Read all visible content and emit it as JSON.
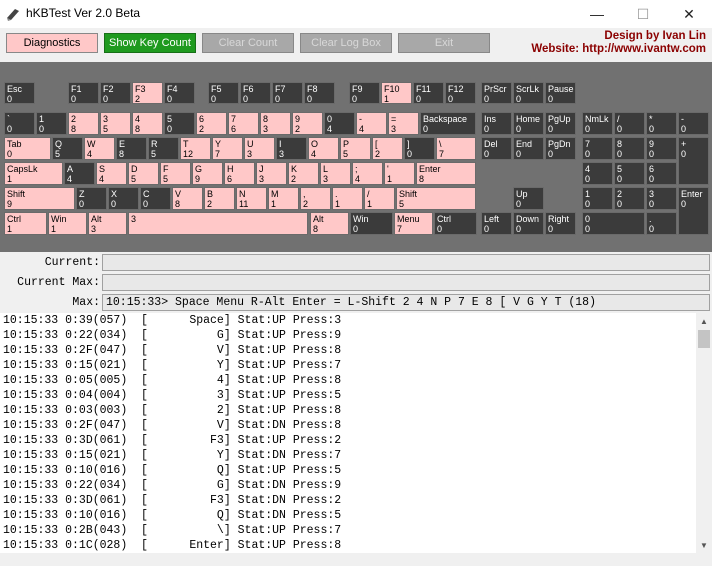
{
  "window": {
    "title": "hKBTest Ver 2.0 Beta",
    "minimize": "—",
    "maximize": "☐",
    "close": "✕"
  },
  "toolbar": {
    "diagnostics": "Diagnostics",
    "show_key_count": "Show Key Count",
    "clear_count": "Clear Count",
    "clear_log_box": "Clear Log Box",
    "exit": "Exit"
  },
  "credit": {
    "design": "Design by Ivan Lin",
    "website": "Website: http://www.ivantw.com"
  },
  "status": {
    "current_label": "Current:",
    "current_max_label": "Current Max:",
    "max_label": "Max:",
    "current_value": "",
    "current_max_value": "",
    "max_value": "10:15:33> Space Menu R-Alt Enter = L-Shift 2 4 N P 7 E 8 [ V G Y T (18)"
  },
  "keys": [
    [
      "Esc",
      "0",
      "up"
    ],
    [
      "F1",
      "0",
      "up"
    ],
    [
      "F2",
      "0",
      "up"
    ],
    [
      "F3",
      "2",
      "dn"
    ],
    [
      "F4",
      "0",
      "up"
    ],
    [
      "F5",
      "0",
      "up"
    ],
    [
      "F6",
      "0",
      "up"
    ],
    [
      "F7",
      "0",
      "up"
    ],
    [
      "F8",
      "0",
      "up"
    ],
    [
      "F9",
      "0",
      "up"
    ],
    [
      "F10",
      "1",
      "dn"
    ],
    [
      "F11",
      "0",
      "up"
    ],
    [
      "F12",
      "0",
      "up"
    ],
    [
      "PrScr",
      "0",
      "up"
    ],
    [
      "ScrLk",
      "0",
      "up"
    ],
    [
      "Pause",
      "0",
      "up"
    ],
    [
      "`",
      "0",
      "up"
    ],
    [
      "1",
      "0",
      "up"
    ],
    [
      "2",
      "8",
      "dn"
    ],
    [
      "3",
      "5",
      "dn"
    ],
    [
      "4",
      "8",
      "dn"
    ],
    [
      "5",
      "0",
      "up"
    ],
    [
      "6",
      "2",
      "dn"
    ],
    [
      "7",
      "6",
      "dn"
    ],
    [
      "8",
      "3",
      "dn"
    ],
    [
      "9",
      "2",
      "dn"
    ],
    [
      "0",
      "4",
      "up"
    ],
    [
      "-",
      "4",
      "dn"
    ],
    [
      "=",
      "3",
      "dn"
    ],
    [
      "Backspace",
      "0",
      "up"
    ],
    [
      "Ins",
      "0",
      "up"
    ],
    [
      "Home",
      "0",
      "up"
    ],
    [
      "PgUp",
      "0",
      "up"
    ],
    [
      "NmLk",
      "0",
      "up"
    ],
    [
      "/",
      "0",
      "up"
    ],
    [
      "*",
      "0",
      "up"
    ],
    [
      "-",
      "0",
      "up"
    ],
    [
      "Tab",
      "0",
      "dn"
    ],
    [
      "Q",
      "5",
      "up"
    ],
    [
      "W",
      "4",
      "dn"
    ],
    [
      "E",
      "8",
      "up"
    ],
    [
      "R",
      "5",
      "up"
    ],
    [
      "T",
      "12",
      "dn"
    ],
    [
      "Y",
      "7",
      "dn"
    ],
    [
      "U",
      "3",
      "dn"
    ],
    [
      "I",
      "3",
      "up"
    ],
    [
      "O",
      "4",
      "dn"
    ],
    [
      "P",
      "5",
      "dn"
    ],
    [
      "[",
      "2",
      "dn"
    ],
    [
      "]",
      "0",
      "up"
    ],
    [
      "\\",
      "7",
      "dn"
    ],
    [
      "Del",
      "0",
      "up"
    ],
    [
      "End",
      "0",
      "up"
    ],
    [
      "PgDn",
      "0",
      "up"
    ],
    [
      "7",
      "0",
      "up"
    ],
    [
      "8",
      "0",
      "up"
    ],
    [
      "9",
      "0",
      "up"
    ],
    [
      "+",
      "0",
      "up"
    ],
    [
      "CapsLk",
      "1",
      "dn"
    ],
    [
      "A",
      "4",
      "up"
    ],
    [
      "S",
      "4",
      "dn"
    ],
    [
      "D",
      "5",
      "dn"
    ],
    [
      "F",
      "5",
      "dn"
    ],
    [
      "G",
      "9",
      "dn"
    ],
    [
      "H",
      "6",
      "dn"
    ],
    [
      "J",
      "3",
      "dn"
    ],
    [
      "K",
      "2",
      "dn"
    ],
    [
      "L",
      "3",
      "dn"
    ],
    [
      ";",
      "4",
      "dn"
    ],
    [
      "'",
      "1",
      "dn"
    ],
    [
      "Enter",
      "8",
      "dn"
    ],
    [
      "4",
      "0",
      "up"
    ],
    [
      "5",
      "0",
      "up"
    ],
    [
      "6",
      "0",
      "up"
    ],
    [
      "Shift",
      "9",
      "dn"
    ],
    [
      "Z",
      "0",
      "up"
    ],
    [
      "X",
      "0",
      "up"
    ],
    [
      "C",
      "0",
      "up"
    ],
    [
      "V",
      "8",
      "dn"
    ],
    [
      "B",
      "2",
      "dn"
    ],
    [
      "N",
      "11",
      "dn"
    ],
    [
      "M",
      "1",
      "dn"
    ],
    [
      ",",
      "2",
      "dn"
    ],
    [
      ".",
      "1",
      "dn"
    ],
    [
      "/",
      "1",
      "dn"
    ],
    [
      "Shift",
      "5",
      "dn"
    ],
    [
      "Up",
      "0",
      "up"
    ],
    [
      "1",
      "0",
      "up"
    ],
    [
      "2",
      "0",
      "up"
    ],
    [
      "3",
      "0",
      "up"
    ],
    [
      "Enter",
      "0",
      "up"
    ],
    [
      "Ctrl",
      "1",
      "dn"
    ],
    [
      "Win",
      "1",
      "dn"
    ],
    [
      "Alt",
      "3",
      "dn"
    ],
    [
      "",
      "3",
      "dn"
    ],
    [
      "Alt",
      "8",
      "dn"
    ],
    [
      "Win",
      "0",
      "up"
    ],
    [
      "Menu",
      "7",
      "dn"
    ],
    [
      "Ctrl",
      "0",
      "up"
    ],
    [
      "Left",
      "0",
      "up"
    ],
    [
      "Down",
      "0",
      "up"
    ],
    [
      "Right",
      "0",
      "up"
    ],
    [
      "0",
      "0",
      "up"
    ],
    [
      ".",
      "0",
      "up"
    ]
  ],
  "log": [
    "10:15:33 0:39(057)  [      Space] Stat:UP Press:3",
    "10:15:33 0:22(034)  [          G] Stat:UP Press:9",
    "10:15:33 0:2F(047)  [          V] Stat:UP Press:8",
    "10:15:33 0:15(021)  [          Y] Stat:UP Press:7",
    "10:15:33 0:05(005)  [          4] Stat:UP Press:8",
    "10:15:33 0:04(004)  [          3] Stat:UP Press:5",
    "10:15:33 0:03(003)  [          2] Stat:UP Press:8",
    "10:15:33 0:2F(047)  [          V] Stat:DN Press:8",
    "10:15:33 0:3D(061)  [         F3] Stat:UP Press:2",
    "10:15:33 0:15(021)  [          Y] Stat:DN Press:7",
    "10:15:33 0:10(016)  [          Q] Stat:UP Press:5",
    "10:15:33 0:22(034)  [          G] Stat:DN Press:9",
    "10:15:33 0:3D(061)  [         F3] Stat:DN Press:2",
    "10:15:33 0:10(016)  [          Q] Stat:DN Press:5",
    "10:15:33 0:2B(043)  [          \\] Stat:UP Press:7",
    "10:15:33 0:1C(028)  [      Enter] Stat:UP Press:8"
  ],
  "colors": {
    "key_up": "#3b3b3b",
    "key_down": "#ffc8c8",
    "keyboard_bg": "#717171",
    "credit": "#8b0000",
    "show_key_count_bg": "#1f9a1f",
    "diagnostics_bg": "#ffc8c8"
  }
}
